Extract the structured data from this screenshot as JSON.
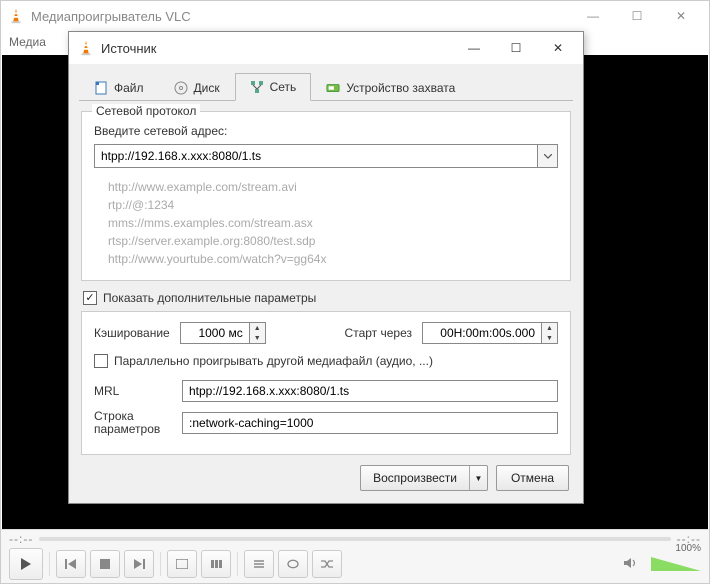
{
  "main": {
    "title": "Медиапроигрыватель VLC",
    "menu_media": "Медиа",
    "time_left": "--:--",
    "time_right": "--:--",
    "volume_pct": "100%"
  },
  "dialog": {
    "title": "Источник",
    "tabs": {
      "file": "Файл",
      "disc": "Диск",
      "network": "Сеть",
      "capture": "Устройство захвата"
    },
    "group_legend": "Сетевой протокол",
    "url_label": "Введите сетевой адрес:",
    "url_value": "htpp://192.168.x.xxx:8080/1.ts",
    "examples": [
      "http://www.example.com/stream.avi",
      "rtp://@:1234",
      "mms://mms.examples.com/stream.asx",
      "rtsp://server.example.org:8080/test.sdp",
      "http://www.yourtube.com/watch?v=gg64x"
    ],
    "show_advanced": "Показать дополнительные параметры",
    "caching_label": "Кэширование",
    "caching_value": "1000 мс",
    "start_label": "Старт через",
    "start_value": "00H:00m:00s.000",
    "parallel_label": "Параллельно проигрывать другой медиафайл (аудио, ...)",
    "mrl_label": "MRL",
    "mrl_value": "htpp://192.168.x.xxx:8080/1.ts",
    "params_label": "Строка параметров",
    "params_value": ":network-caching=1000",
    "play_btn": "Воспроизвести",
    "cancel_btn": "Отмена"
  }
}
